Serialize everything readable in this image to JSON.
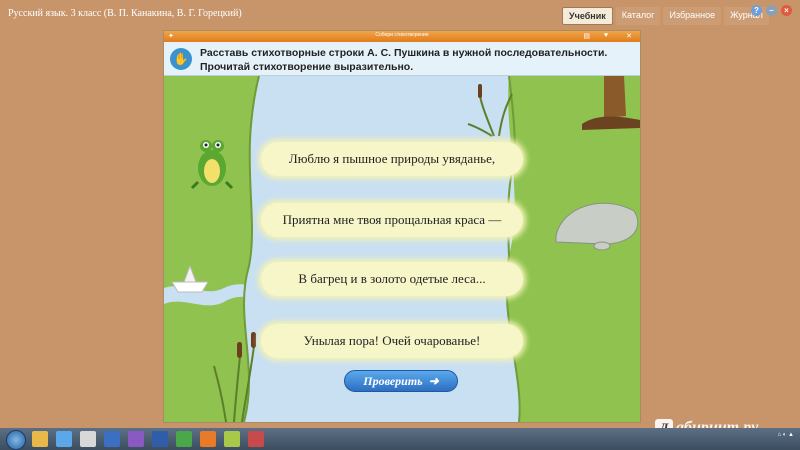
{
  "app": {
    "title": "Русский язык. 3 класс (В. П. Канакина, В. Г. Горецкий)"
  },
  "nav": {
    "tabs": [
      {
        "label": "Учебник",
        "active": true
      },
      {
        "label": "Каталог",
        "active": false
      },
      {
        "label": "Избранное",
        "active": false
      },
      {
        "label": "Журнал",
        "active": false
      }
    ]
  },
  "exercise": {
    "window_title": "Собери стихотворение",
    "instructions": "Расставь стихотворные строки А. С. Пушкина в нужной последовательности. Прочитай стихотворение выразительно.",
    "lines": [
      "Люблю я пышное природы увяданье,",
      "Приятна мне твоя прощальная краса —",
      "В багрец и в золото одетые леса...",
      "Унылая пора! Очей очарованье!"
    ],
    "check_label": "Проверить"
  },
  "watermark": {
    "text": "абиринт.ру"
  },
  "colors": {
    "background": "#c8956a",
    "grass": "#8fc24f",
    "river": "#c9dff2",
    "card": "#f6f6c9",
    "button": "#2d6fc2"
  }
}
